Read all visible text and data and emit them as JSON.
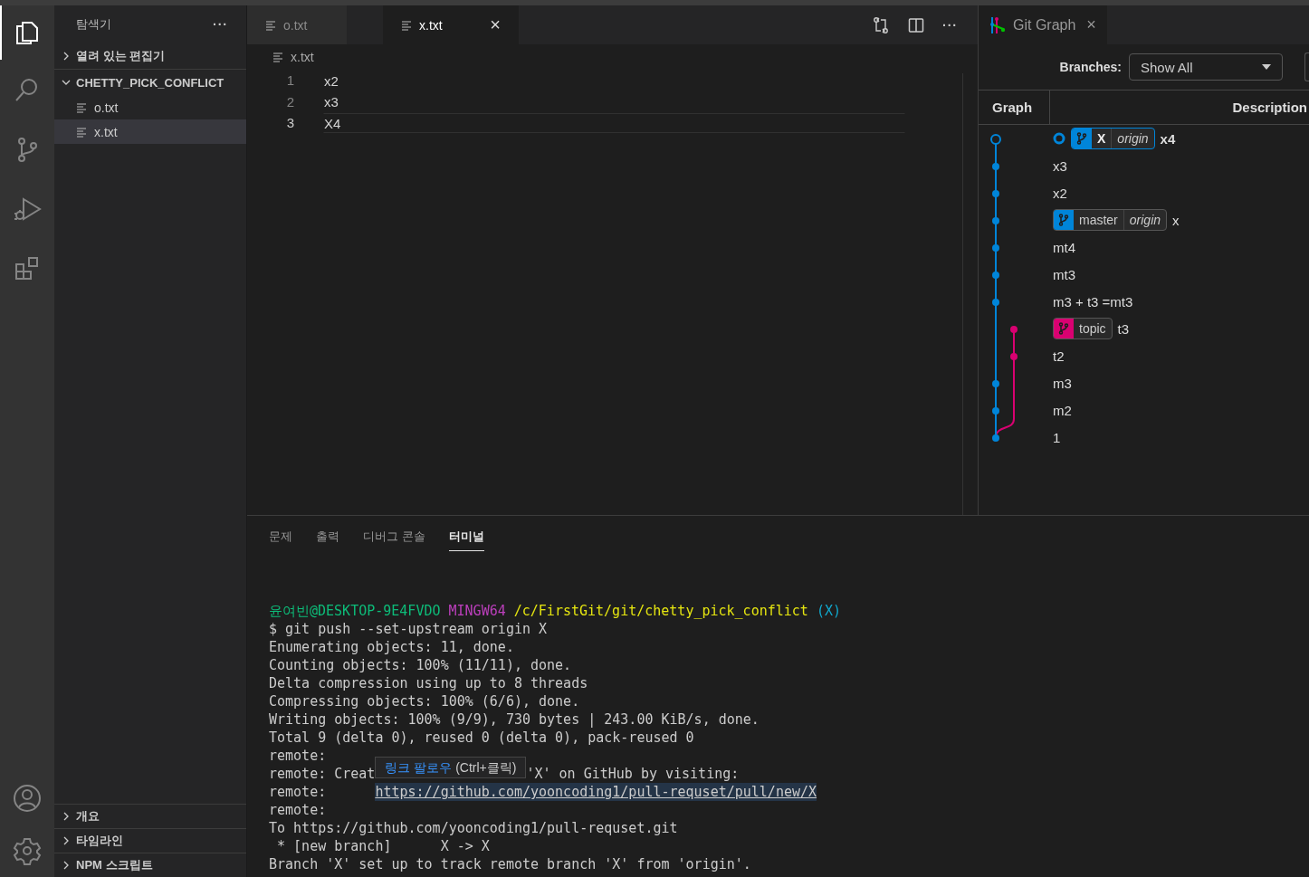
{
  "activity_bar": {
    "items": [
      {
        "kind": "files",
        "selected": true
      },
      {
        "kind": "search",
        "selected": false
      },
      {
        "kind": "source-control",
        "selected": false
      },
      {
        "kind": "run-debug",
        "selected": false
      },
      {
        "kind": "extensions",
        "selected": false
      }
    ],
    "bottom": [
      {
        "kind": "account"
      },
      {
        "kind": "settings"
      }
    ]
  },
  "sidebar": {
    "title": "탐색기",
    "more": "···",
    "sections": [
      {
        "label": "열려 있는 편집기",
        "expanded": false
      },
      {
        "label": "CHETTY_PICK_CONFLICT",
        "expanded": true,
        "children": [
          {
            "label": "o.txt",
            "selected": false
          },
          {
            "label": "x.txt",
            "selected": true
          }
        ]
      }
    ],
    "bottom_sections": [
      {
        "label": "개요",
        "expanded": false
      },
      {
        "label": "타임라인",
        "expanded": false
      },
      {
        "label": "NPM 스크립트",
        "expanded": false
      }
    ]
  },
  "editor": {
    "tabs": [
      {
        "label": "o.txt",
        "selected": false
      },
      {
        "label": "x.txt",
        "selected": true,
        "close": "×"
      }
    ],
    "actions": [
      {
        "kind": "compare"
      },
      {
        "kind": "split"
      },
      {
        "kind": "more"
      }
    ],
    "more": "···",
    "breadcrumb": "x.txt",
    "lines": [
      {
        "number": "1",
        "text": "x2",
        "selected": false
      },
      {
        "number": "2",
        "text": "x3",
        "selected": false
      },
      {
        "number": "3",
        "text": "X4",
        "selected": true
      }
    ]
  },
  "git_graph": {
    "tab": {
      "label": "Git Graph",
      "close": "×"
    },
    "branches_label": "Branches:",
    "branches_value": "Show All",
    "columns": [
      "Graph",
      "Description"
    ],
    "commits": [
      {
        "message": "x4",
        "kind": "main",
        "color": "#0085d9",
        "head": true,
        "refs": [
          {
            "name": "X",
            "remote": "origin",
            "color": "#0085d9"
          }
        ]
      },
      {
        "message": "x3",
        "kind": "main",
        "color": "#0085d9",
        "head": false
      },
      {
        "message": "x2",
        "kind": "main",
        "color": "#0085d9",
        "head": false
      },
      {
        "message": "x",
        "kind": "main",
        "color": "#0085d9",
        "head": false,
        "refs": [
          {
            "name": "master",
            "remote": "origin",
            "color": "#0085d9"
          }
        ]
      },
      {
        "message": "mt4",
        "kind": "main",
        "color": "#0085d9",
        "head": false
      },
      {
        "message": "mt3",
        "kind": "main",
        "color": "#0085d9",
        "head": false
      },
      {
        "message": "m3 + t3 =mt3",
        "kind": "main",
        "color": "#0085d9",
        "head": false
      },
      {
        "message": "t3",
        "kind": "side",
        "color": "#d90171",
        "head": false,
        "refs": [
          {
            "name": "topic",
            "color": "#d90171"
          }
        ]
      },
      {
        "message": "t2",
        "kind": "side",
        "color": "#d90171",
        "head": false
      },
      {
        "message": "m3",
        "kind": "main",
        "color": "#0085d9",
        "head": false
      },
      {
        "message": "m2",
        "kind": "main",
        "color": "#0085d9",
        "head": false
      },
      {
        "message": "1",
        "kind": "main",
        "color": "#0085d9",
        "head": false
      }
    ]
  },
  "panel": {
    "tabs": [
      {
        "label": "문제",
        "selected": false
      },
      {
        "label": "출력",
        "selected": false
      },
      {
        "label": "디버그 콘솔",
        "selected": false
      },
      {
        "label": "터미널",
        "selected": true
      }
    ],
    "terminal": [
      [
        {
          "kind": "user",
          "text": "윤여빈@DESKTOP-9E4FVDO"
        },
        {
          "kind": "shell",
          "text": "MINGW64"
        },
        {
          "kind": "path",
          "text": "/c/FirstGit/git/chetty_pick_conflict"
        },
        {
          "kind": "branch",
          "text": "(X)"
        }
      ],
      [
        {
          "kind": "plain",
          "text": "$ git push --set-upstream origin X"
        }
      ],
      [
        {
          "kind": "plain",
          "text": "Enumerating objects: 11, done."
        }
      ],
      [
        {
          "kind": "plain",
          "text": "Counting objects: 100% (11/11), done."
        }
      ],
      [
        {
          "kind": "plain",
          "text": "Delta compression using up to 8 threads"
        }
      ],
      [
        {
          "kind": "plain",
          "text": "Compressing objects: 100% (6/6), done."
        }
      ],
      [
        {
          "kind": "plain",
          "text": "Writing objects: 100% (9/9), 730 bytes | 243.00 KiB/s, done."
        }
      ],
      [
        {
          "kind": "plain",
          "text": "Total 9 (delta 0), reused 0 (delta 0), pack-reused 0"
        }
      ],
      [
        {
          "kind": "plain",
          "text": "remote:"
        }
      ],
      [
        {
          "kind": "plain",
          "text": "remote: Creat"
        },
        {
          "kind": "tooltip",
          "text": "링크 팔로우",
          "hint": "(Ctrl+클릭)"
        },
        {
          "kind": "plain",
          "text": "'X' on GitHub by visiting:"
        }
      ],
      [
        {
          "kind": "plain",
          "text": "remote:"
        },
        {
          "kind": "link",
          "text": "https://github.com/yooncoding1/pull-requset/pull/new/X"
        }
      ],
      [
        {
          "kind": "plain",
          "text": "remote:"
        }
      ],
      [
        {
          "kind": "plain",
          "text": "To https://github.com/yooncoding1/pull-requset.git"
        }
      ],
      [
        {
          "kind": "plain",
          "text": " * [new branch]      X -> X"
        }
      ],
      [
        {
          "kind": "plain",
          "text": "Branch 'X' set up to track remote branch 'X' from 'origin'."
        }
      ]
    ]
  }
}
